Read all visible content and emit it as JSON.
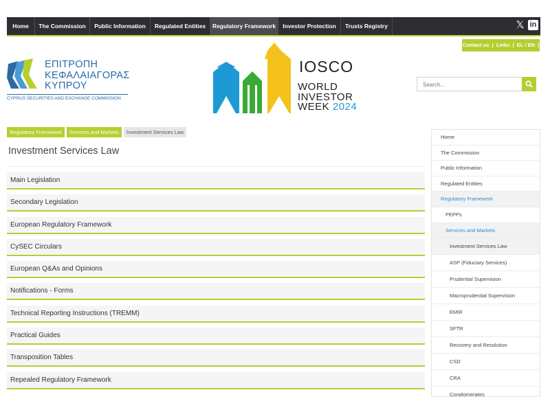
{
  "topnav": {
    "items": [
      "Home",
      "The Commission",
      "Public Information",
      "Regulated Entities",
      "Regulatory Framework",
      "Investor Protection",
      "Trusts Registry"
    ],
    "active_index": 4,
    "social": {
      "x": "𝕏",
      "linkedin": "in"
    }
  },
  "contact_bar": {
    "contact": "Contact us",
    "links": "Links",
    "lang": "EL / EN"
  },
  "logo": {
    "line1": "ΕΠΙΤΡΟΠΗ",
    "line2": "ΚΕΦΑΛΑΙΑΓΟΡΑΣ",
    "line3": "ΚΥΠΡΟΥ",
    "subtitle": "CYPRUS SECURITIES AND EXCHANGE COMMISSION"
  },
  "banner": {
    "iosco": "IOSCO",
    "line1": "WORLD",
    "line2": "INVESTOR",
    "line3": "WEEK",
    "year": "2024"
  },
  "search": {
    "placeholder": "Search..."
  },
  "breadcrumb": [
    "Regulatory Framework",
    "Services and Markets",
    "Investment Services Law"
  ],
  "page_title": "Investment Services Law",
  "accordion": [
    "Main Legislation",
    "Secondary Legislation",
    "European Regulatory Framework",
    "CySEC Circulars",
    "European Q&As and Opinions",
    "Notifications - Forms",
    "Technical Reporting Instructions (TREMM)",
    "Practical Guides",
    "Transposition Tables",
    "Repealed Regulatory Framework"
  ],
  "sidemenu": {
    "level1": [
      "Home",
      "The Commission",
      "Public Information",
      "Regulated Entities",
      "Regulatory Framework"
    ],
    "level2": [
      "PEPPs",
      "Services and Markets"
    ],
    "level3": [
      "Investment Services Law",
      "ASP (Fiduciary Services)",
      "Prudential Supervision",
      "Macroprudential Supervision",
      "EMIR",
      "SFTR",
      "Recovery and Resolution",
      "CSD",
      "CRA",
      "Conglomerates"
    ]
  },
  "colors": {
    "accent": "#b5cf30",
    "nav_bg": "#2c2e33",
    "brand_blue": "#2b6aa3",
    "link_blue": "#2b8ed0"
  }
}
